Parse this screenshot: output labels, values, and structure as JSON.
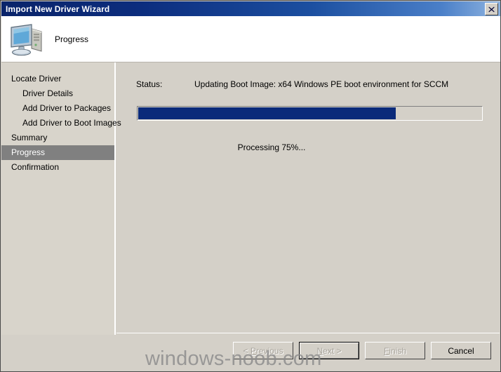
{
  "window": {
    "title": "Import New Driver Wizard",
    "close_label": "Close"
  },
  "header": {
    "title": "Progress",
    "icon": "computer-icon"
  },
  "sidebar": {
    "items": [
      {
        "label": "Locate Driver",
        "level": 0,
        "active": false
      },
      {
        "label": "Driver Details",
        "level": 1,
        "active": false
      },
      {
        "label": "Add Driver to Packages",
        "level": 1,
        "active": false
      },
      {
        "label": "Add Driver to Boot Images",
        "level": 1,
        "active": false
      },
      {
        "label": "Summary",
        "level": 0,
        "active": false
      },
      {
        "label": "Progress",
        "level": 0,
        "active": true
      },
      {
        "label": "Confirmation",
        "level": 0,
        "active": false
      }
    ]
  },
  "content": {
    "status_label": "Status:",
    "status_value": "Updating Boot Image: x64 Windows PE boot environment for SCCM",
    "processing_text": "Processing 75%...",
    "progress_percent": 75,
    "progress_fill_color": "#0a2a7a"
  },
  "footer": {
    "buttons": [
      {
        "label": "< Previous",
        "accel": "P",
        "enabled": false,
        "default": false
      },
      {
        "label": "Next >",
        "accel": "N",
        "enabled": false,
        "default": true
      },
      {
        "label": "Finish",
        "accel": "F",
        "enabled": false,
        "default": false
      },
      {
        "label": "Cancel",
        "accel": "",
        "enabled": true,
        "default": false
      }
    ]
  },
  "watermark": {
    "text": "windows-noob.com"
  }
}
